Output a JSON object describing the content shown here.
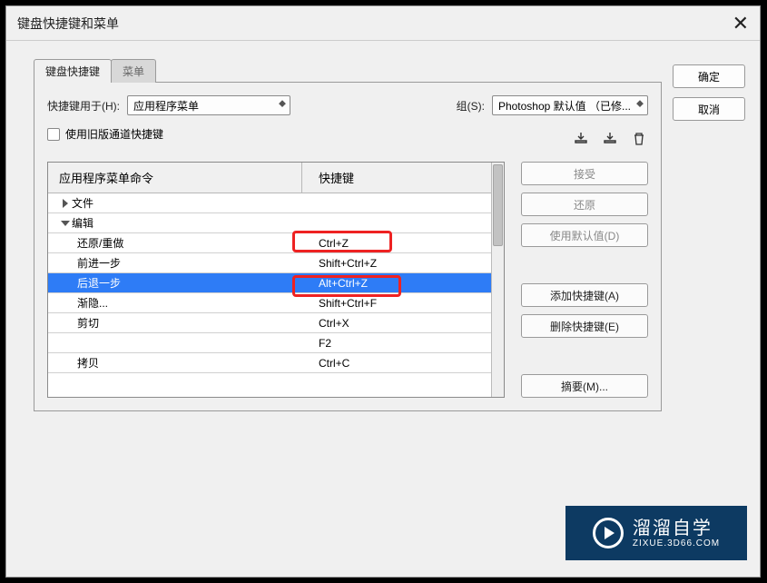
{
  "titlebar": {
    "title": "键盘快捷键和菜单"
  },
  "side": {
    "ok": "确定",
    "cancel": "取消"
  },
  "tabs": {
    "t1": "键盘快捷键",
    "t2": "菜单"
  },
  "form": {
    "shortcut_for_label": "快捷键用于(H):",
    "shortcut_for_value": "应用程序菜单",
    "set_label": "组(S):",
    "set_value": "Photoshop 默认值 （已修...",
    "legacy_checkbox": "使用旧版通道快捷键"
  },
  "table": {
    "col_cmd": "应用程序菜单命令",
    "col_key": "快捷键",
    "rows": [
      {
        "type": "group",
        "expanded": false,
        "label": "文件",
        "key": ""
      },
      {
        "type": "group",
        "expanded": true,
        "label": "编辑",
        "key": ""
      },
      {
        "type": "item",
        "label": "还原/重做",
        "key": "Ctrl+Z"
      },
      {
        "type": "item",
        "label": "前进一步",
        "key": "Shift+Ctrl+Z"
      },
      {
        "type": "item",
        "label": "后退一步",
        "key": "Alt+Ctrl+Z",
        "selected": true
      },
      {
        "type": "item",
        "label": "渐隐...",
        "key": "Shift+Ctrl+F"
      },
      {
        "type": "item",
        "label": "剪切",
        "key": "Ctrl+X"
      },
      {
        "type": "item",
        "label": "",
        "key": "F2"
      },
      {
        "type": "item",
        "label": "拷贝",
        "key": "Ctrl+C"
      }
    ]
  },
  "actions": {
    "accept": "接受",
    "undo": "还原",
    "use_default": "使用默认值(D)",
    "add": "添加快捷键(A)",
    "delete": "删除快捷键(E)",
    "summary": "摘要(M)..."
  },
  "watermark": {
    "brand": "溜溜自学",
    "url": "ZIXUE.3D66.COM"
  }
}
